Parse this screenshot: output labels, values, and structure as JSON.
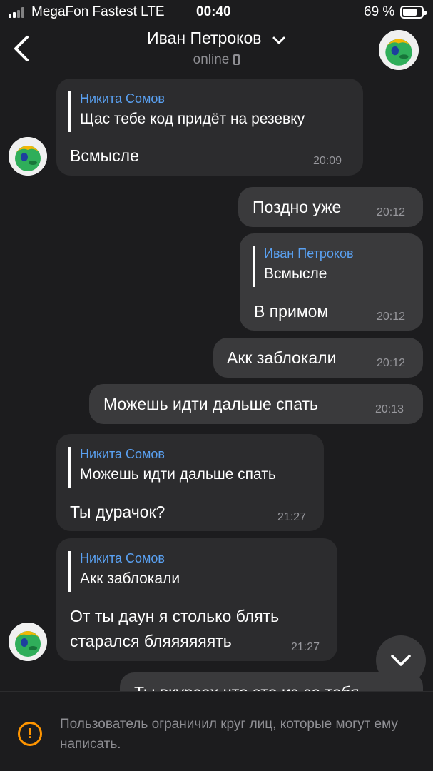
{
  "status_bar": {
    "carrier": "MegaFon Fastest  LTE",
    "time": "00:40",
    "battery_percent": "69 %",
    "battery_level": 0.69
  },
  "header": {
    "title": "Иван Петроков",
    "subtitle": "online",
    "back_icon": "chevron-left-icon",
    "expand_icon": "chevron-down-icon",
    "device_icon": "phone-icon"
  },
  "messages": [
    {
      "direction": "in",
      "quote_name": "Никита Сомов",
      "quote_text": "Щас тебе код придёт на резевку",
      "text": "Всмысле",
      "time": "20:09"
    },
    {
      "direction": "out",
      "text": "Поздно уже",
      "time": "20:12"
    },
    {
      "direction": "out",
      "quote_name": "Иван Петроков",
      "quote_text": "Всмысле",
      "text": "В примом",
      "time": "20:12"
    },
    {
      "direction": "out",
      "text": "Акк заблокали",
      "time": "20:12"
    },
    {
      "direction": "out",
      "text": "Можешь идти дальше спать",
      "time": "20:13"
    },
    {
      "direction": "in",
      "quote_name": "Никита Сомов",
      "quote_text": "Можешь идти дальше спать",
      "text": "Ты дурачок?",
      "time": "21:27"
    },
    {
      "direction": "in",
      "quote_name": "Никита Сомов",
      "quote_text": "Акк заблокали",
      "text": "От ты даун я столько блять\nстарался бляяяяяять",
      "time": "21:27"
    },
    {
      "direction": "out",
      "text": "Ты вкурсах что это из-за тебя"
    }
  ],
  "scroll_icon": "chevron-down-icon",
  "restriction": {
    "icon": "warning-icon",
    "text": "Пользователь ограничил круг лиц, которые могут ему написать."
  },
  "colors": {
    "background": "#1c1c1e",
    "bubble_in": "#2c2c2e",
    "bubble_out": "#3a3a3c",
    "quote_name": "#5aa1f2",
    "warning": "#ff9500"
  }
}
